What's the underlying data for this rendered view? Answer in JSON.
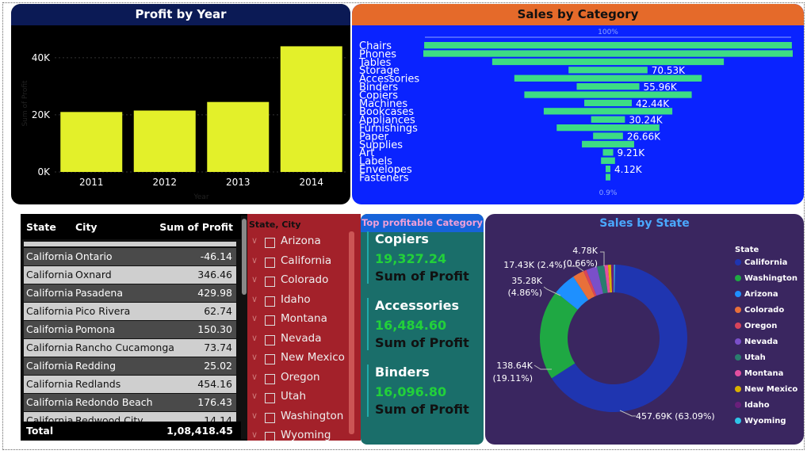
{
  "profit_panel": {
    "title": "Profit by Year",
    "ylabel": "Sum of Profit",
    "xlabel": "Year"
  },
  "sales_panel": {
    "title": "Sales by Category",
    "top_pct": "100%",
    "bottom_pct": "0.9%"
  },
  "table": {
    "headers": [
      "State",
      "City",
      "Sum of Profit"
    ],
    "rows": [
      [
        "California",
        "Ontario",
        "-46.14"
      ],
      [
        "California",
        "Oxnard",
        "346.46"
      ],
      [
        "California",
        "Pasadena",
        "429.98"
      ],
      [
        "California",
        "Pico Rivera",
        "62.74"
      ],
      [
        "California",
        "Pomona",
        "150.30"
      ],
      [
        "California",
        "Rancho Cucamonga",
        "73.74"
      ],
      [
        "California",
        "Redding",
        "25.02"
      ],
      [
        "California",
        "Redlands",
        "454.16"
      ],
      [
        "California",
        "Redondo Beach",
        "176.43"
      ],
      [
        "California",
        "Redwood City",
        "14.14"
      ]
    ],
    "total_label": "Total",
    "total_value": "1,08,418.45"
  },
  "slicer": {
    "title": "State, City",
    "items": [
      "Arizona",
      "California",
      "Colorado",
      "Idaho",
      "Montana",
      "Nevada",
      "New Mexico",
      "Oregon",
      "Utah",
      "Washington",
      "Wyoming"
    ]
  },
  "topcat": {
    "title": "Top profitable Category",
    "items": [
      {
        "name": "Copiers",
        "value": "19,327.24",
        "label": "Sum of Profit"
      },
      {
        "name": "Accessories",
        "value": "16,484.60",
        "label": "Sum of Profit"
      },
      {
        "name": "Binders",
        "value": "16,096.80",
        "label": "Sum of Profit"
      }
    ]
  },
  "state_panel": {
    "title": "Sales by State",
    "legend_title": "State",
    "legend": [
      {
        "name": "California",
        "color": "#1f35b0"
      },
      {
        "name": "Washington",
        "color": "#1fa843"
      },
      {
        "name": "Arizona",
        "color": "#1e90ff"
      },
      {
        "name": "Colorado",
        "color": "#e8703a"
      },
      {
        "name": "Oregon",
        "color": "#d9445a"
      },
      {
        "name": "Nevada",
        "color": "#7a4fc9"
      },
      {
        "name": "Utah",
        "color": "#2a7d6e"
      },
      {
        "name": "Montana",
        "color": "#e34fa0"
      },
      {
        "name": "New Mexico",
        "color": "#d9b000"
      },
      {
        "name": "Idaho",
        "color": "#6a1f7a"
      },
      {
        "name": "Wyoming",
        "color": "#2ec4e8"
      }
    ],
    "labels": {
      "california": "457.69K (63.09%)",
      "washington_v": "138.64K",
      "washington_p": "(19.11%)",
      "arizona_v": "35.28K",
      "arizona_p": "(4.86%)",
      "colorado": "17.43K (2.4%)",
      "oregon_v": "4.78K",
      "oregon_p": "(0.66%)"
    }
  },
  "chart_data": [
    {
      "type": "bar",
      "title": "Profit by Year",
      "categories": [
        "2011",
        "2012",
        "2013",
        "2014"
      ],
      "values": [
        21000,
        21500,
        24500,
        44000
      ],
      "xlabel": "Year",
      "ylabel": "Sum of Profit",
      "yticks": [
        "0K",
        "20K",
        "40K"
      ],
      "ylim": [
        0,
        48000
      ],
      "color": "#e3f02a"
    },
    {
      "type": "bar",
      "subtype": "funnel",
      "title": "Sales by Category",
      "categories": [
        "Chairs",
        "Phones",
        "Tables",
        "Storage",
        "Accessories",
        "Binders",
        "Copiers",
        "Machines",
        "Bookcases",
        "Appliances",
        "Furnishings",
        "Paper",
        "Supplies",
        "Art",
        "Labels",
        "Envelopes",
        "Fasteners"
      ],
      "values": [
        328450,
        330010,
        206970,
        70530,
        167380,
        55960,
        149530,
        42440,
        114880,
        30240,
        91710,
        26660,
        46670,
        9210,
        12490,
        4120,
        3020
      ],
      "data_labels": {
        "3": "70.53K",
        "5": "55.96K",
        "7": "42.44K",
        "9": "30.24K",
        "11": "26.66K",
        "13": "9.21K",
        "15": "4.12K"
      },
      "color": "#3ddc84"
    },
    {
      "type": "pie",
      "subtype": "donut",
      "title": "Sales by State",
      "categories": [
        "California",
        "Washington",
        "Arizona",
        "Colorado",
        "Oregon",
        "Nevada",
        "Utah",
        "Montana",
        "New Mexico",
        "Idaho",
        "Wyoming"
      ],
      "values": [
        457690,
        138640,
        35280,
        17430,
        4780,
        16730,
        11220,
        5590,
        4780,
        4380,
        1600
      ]
    }
  ]
}
